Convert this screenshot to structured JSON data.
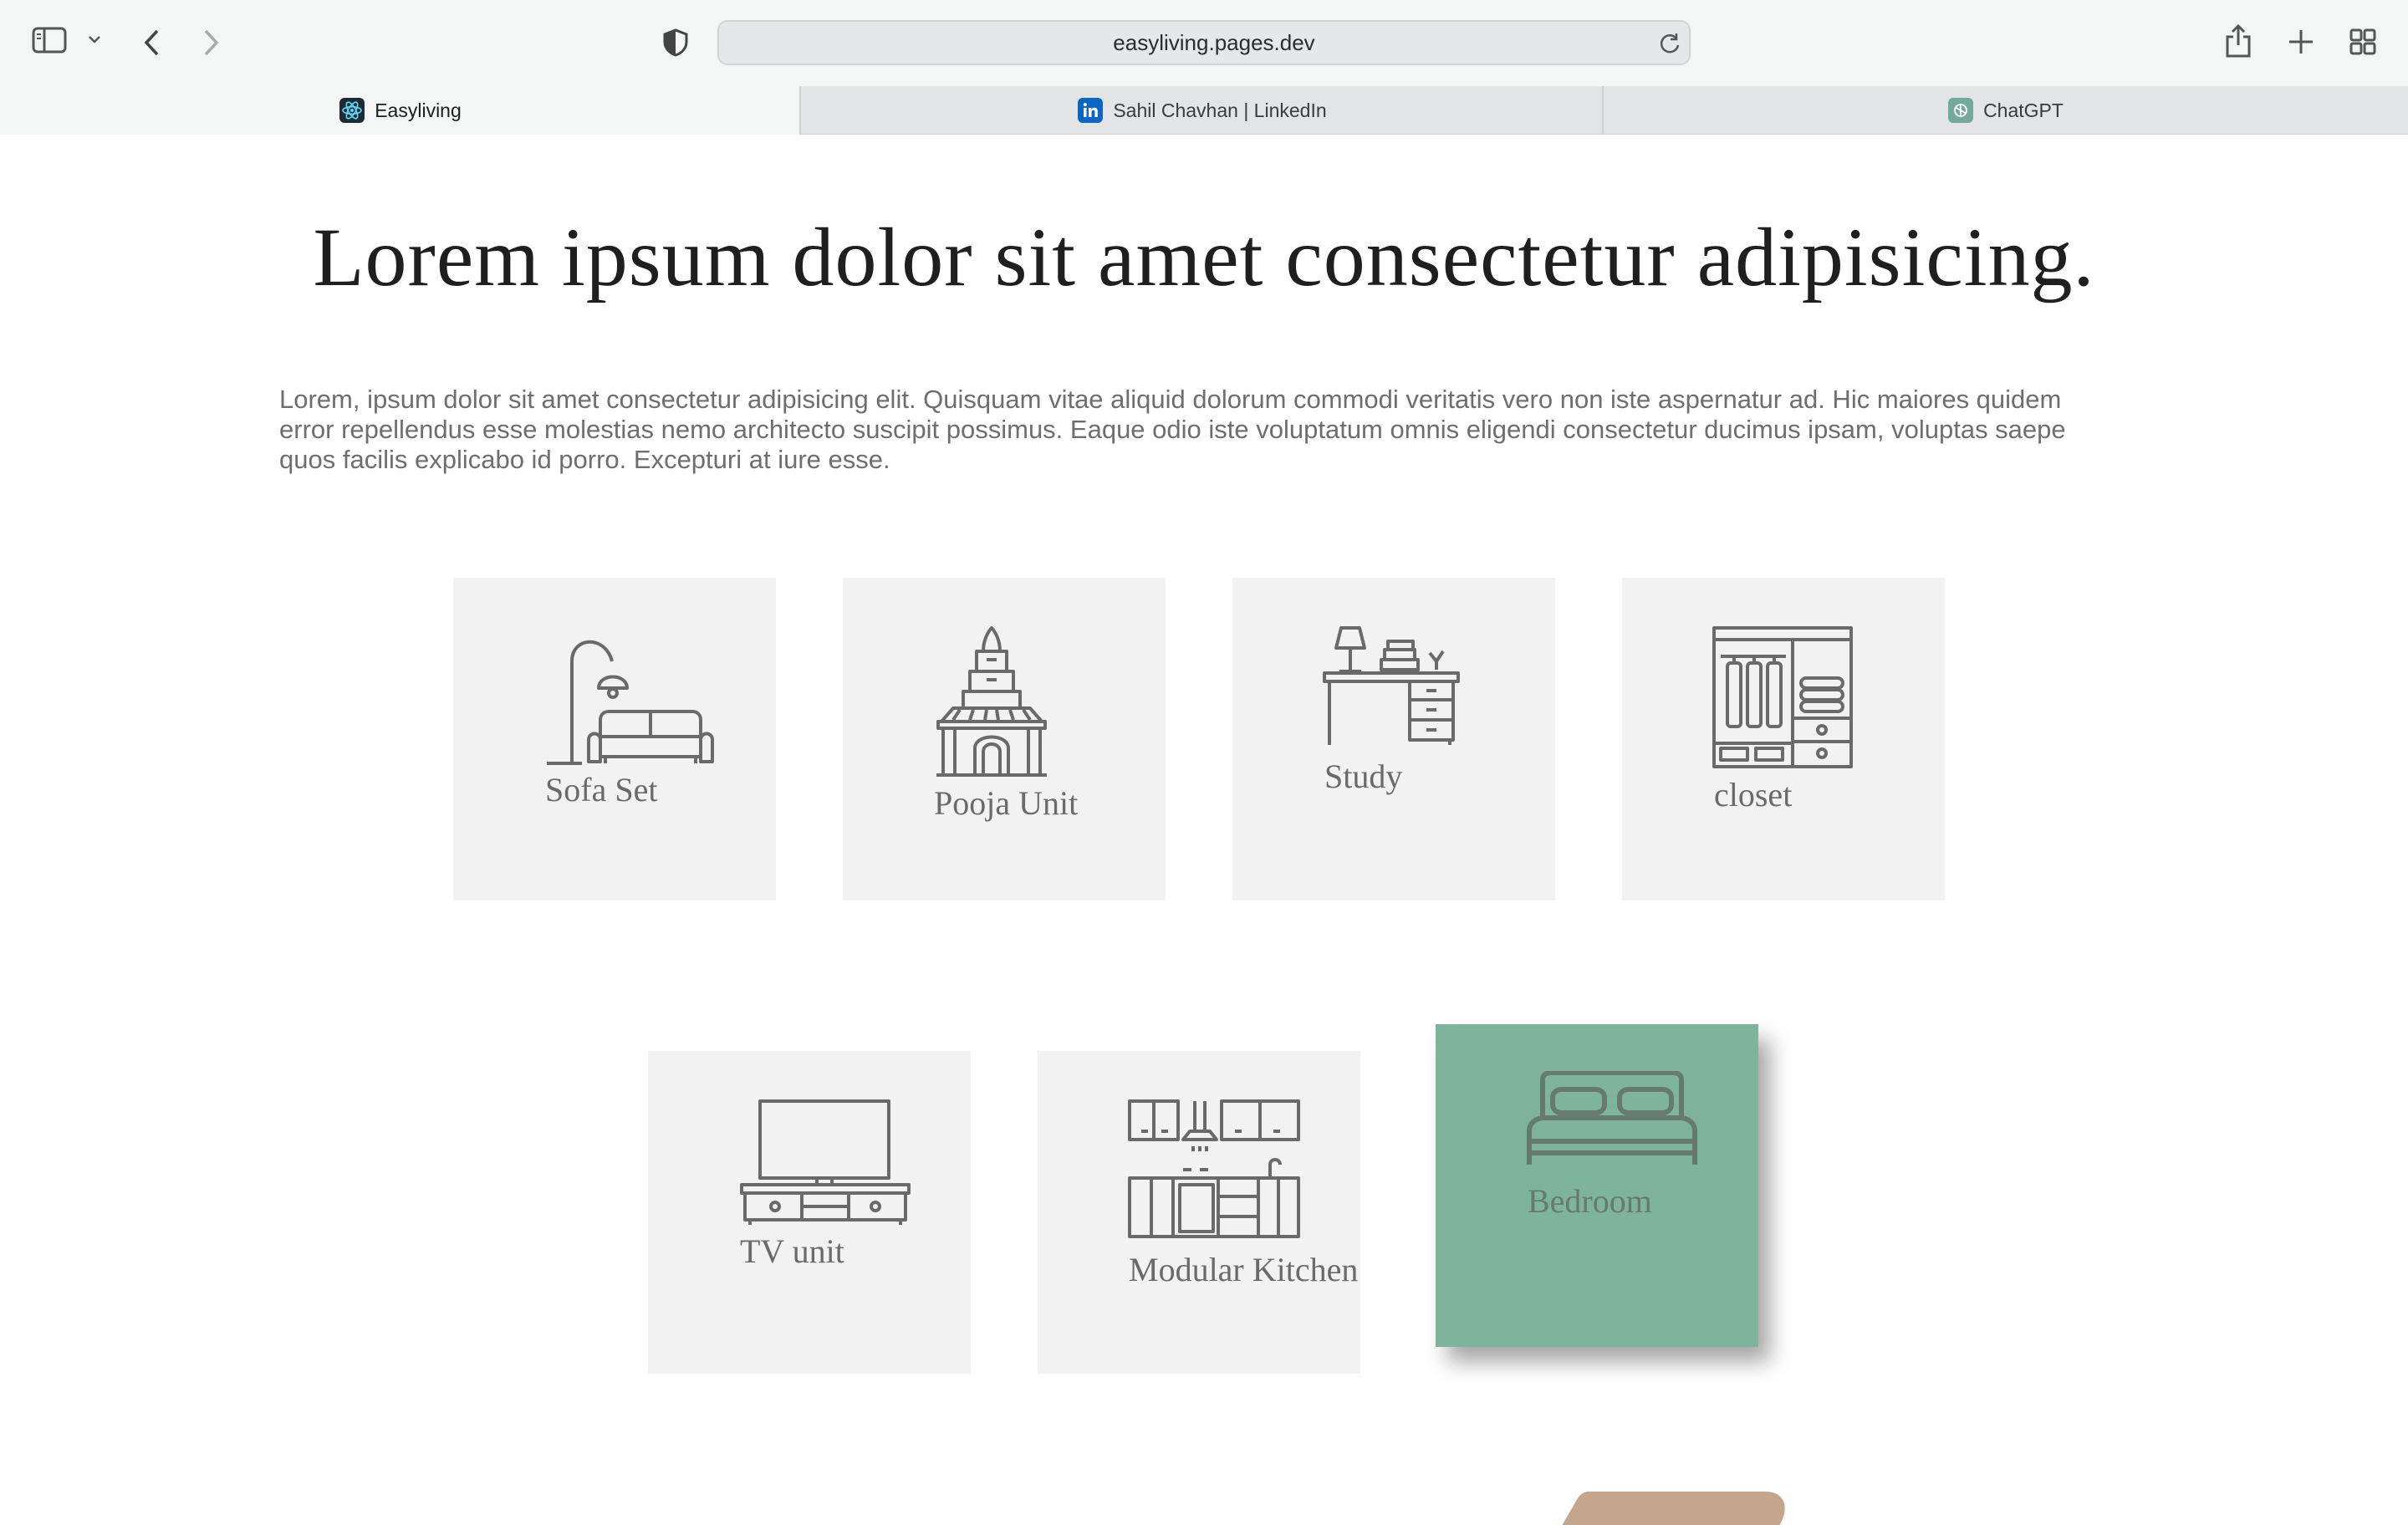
{
  "browser": {
    "url": "easyliving.pages.dev",
    "tabs": [
      {
        "label": "Easyliving",
        "icon": "react-icon"
      },
      {
        "label": "Sahil Chavhan | LinkedIn",
        "icon": "linkedin-icon"
      },
      {
        "label": "ChatGPT",
        "icon": "chatgpt-icon"
      }
    ]
  },
  "hero": {
    "title": "Lorem ipsum dolor sit amet consectetur adipisicing.",
    "text": "Lorem, ipsum dolor sit amet consectetur adipisicing elit. Quisquam vitae aliquid dolorum commodi veritatis vero non iste aspernatur ad. Hic maiores quidem error repellendus esse molestias nemo architecto suscipit possimus. Eaque odio iste voluptatum omnis eligendi consectetur ducimus ipsam, voluptas saepe quos facilis explicabo id porro. Excepturi at iure esse."
  },
  "categories": [
    {
      "label": "Sofa Set",
      "icon": "sofa-lamp-icon"
    },
    {
      "label": "Pooja Unit",
      "icon": "temple-icon"
    },
    {
      "label": "Study",
      "icon": "desk-icon"
    },
    {
      "label": "closet",
      "icon": "wardrobe-icon"
    },
    {
      "label": "TV unit",
      "icon": "tv-unit-icon"
    },
    {
      "label": "Modular Kitchen",
      "icon": "kitchen-icon"
    },
    {
      "label": "Bedroom",
      "icon": "bed-icon",
      "active": true
    }
  ],
  "colors": {
    "card_bg": "#f2f2f2",
    "card_active_bg": "#7fb49c",
    "icon_stroke": "#6a6a6a"
  }
}
